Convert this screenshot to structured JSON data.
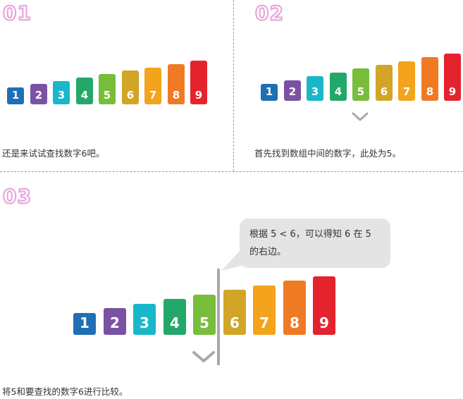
{
  "colors": [
    "#1f6fb4",
    "#7b52a3",
    "#19b7c9",
    "#24a86a",
    "#79bd3c",
    "#d2a526",
    "#f3a31c",
    "#f07a24",
    "#e5232e"
  ],
  "panel1": {
    "step": "01",
    "caption": "还是来试试查找数字6吧。",
    "bars": [
      "1",
      "2",
      "3",
      "4",
      "5",
      "6",
      "7",
      "8",
      "9"
    ]
  },
  "panel2": {
    "step": "02",
    "caption": "首先找到数组中间的数字，此处为5。",
    "bars": [
      "1",
      "2",
      "3",
      "4",
      "5",
      "6",
      "7",
      "8",
      "9"
    ]
  },
  "panel3": {
    "step": "03",
    "caption": "将5和要查找的数字6进行比较。",
    "bubble_line1": "根据 5 < 6，可以得知 6 在 5",
    "bubble_line2": "的右边。",
    "bars": [
      "1",
      "2",
      "3",
      "4",
      "5",
      "6",
      "7",
      "8",
      "9"
    ]
  }
}
